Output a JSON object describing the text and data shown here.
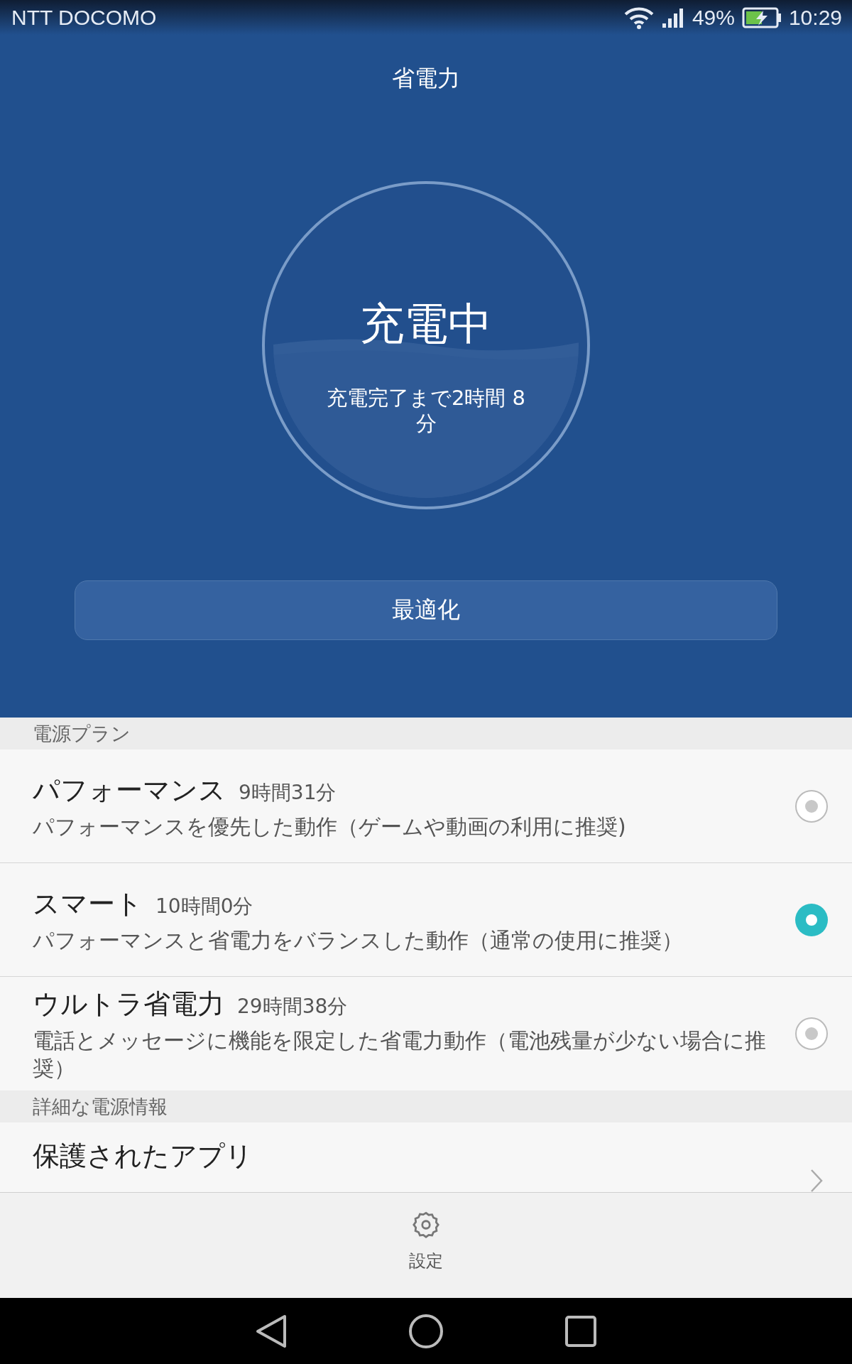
{
  "status_bar": {
    "carrier": "NTT DOCOMO",
    "battery_percent": "49%",
    "charging": true,
    "time": "10:29"
  },
  "header": {
    "title": "省電力"
  },
  "charge_gauge": {
    "status": "充電中",
    "remaining": "充電完了まで2時間 8分"
  },
  "optimize_button": "最適化",
  "plan_section": {
    "title": "電源プラン",
    "plans": [
      {
        "name": "パフォーマンス",
        "time": "9時間31分",
        "description": "パフォーマンスを優先した動作（ゲームや動画の利用に推奨)",
        "selected": false
      },
      {
        "name": "スマート",
        "time": "10時間0分",
        "description": "パフォーマンスと省電力をバランスした動作（通常の使用に推奨）",
        "selected": true
      },
      {
        "name": "ウルトラ省電力",
        "time": "29時間38分",
        "description": "電話とメッセージに機能を限定した省電力動作（電池残量が少ない場合に推奨）",
        "selected": false
      }
    ]
  },
  "detail_section": {
    "title": "詳細な電源情報",
    "items": [
      {
        "title": "保護されたアプリ"
      }
    ]
  },
  "bottom_bar": {
    "label": "設定"
  }
}
